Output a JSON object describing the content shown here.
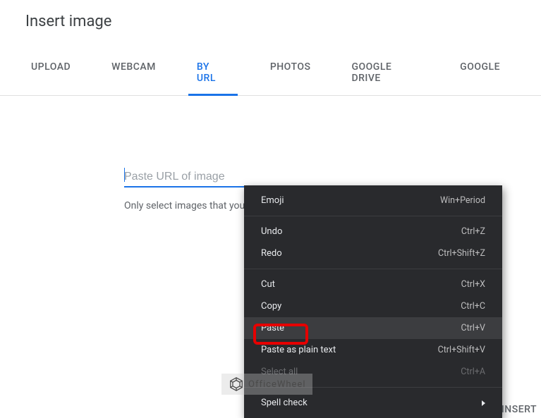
{
  "dialog": {
    "title": "Insert image"
  },
  "tabs": {
    "items": [
      {
        "label": "UPLOAD"
      },
      {
        "label": "WEBCAM"
      },
      {
        "label": "BY URL"
      },
      {
        "label": "PHOTOS"
      },
      {
        "label": "GOOGLE DRIVE"
      },
      {
        "label": "GOOGLE"
      }
    ],
    "active_index": 2
  },
  "url_field": {
    "placeholder": "Paste URL of image",
    "value": "",
    "helper": "Only select images that you have confirmed that you have the license to use."
  },
  "context_menu": {
    "items": [
      {
        "label": "Emoji",
        "shortcut": "Win+Period",
        "type": "item"
      },
      {
        "type": "sep"
      },
      {
        "label": "Undo",
        "shortcut": "Ctrl+Z",
        "type": "item"
      },
      {
        "label": "Redo",
        "shortcut": "Ctrl+Shift+Z",
        "type": "item"
      },
      {
        "type": "sep"
      },
      {
        "label": "Cut",
        "shortcut": "Ctrl+X",
        "type": "item"
      },
      {
        "label": "Copy",
        "shortcut": "Ctrl+C",
        "type": "item"
      },
      {
        "label": "Paste",
        "shortcut": "Ctrl+V",
        "type": "item",
        "hover": true,
        "highlighted": true
      },
      {
        "label": "Paste as plain text",
        "shortcut": "Ctrl+Shift+V",
        "type": "item"
      },
      {
        "label": "Select all",
        "shortcut": "Ctrl+A",
        "type": "item",
        "disabled": true
      },
      {
        "type": "sep"
      },
      {
        "label": "Spell check",
        "shortcut": "",
        "type": "submenu"
      }
    ]
  },
  "footer": {
    "insert_label": "INSERT"
  },
  "watermark": {
    "text": "OfficeWheel"
  },
  "colors": {
    "accent": "#1a73e8",
    "highlight": "#e60000",
    "menubg": "#292a2d"
  }
}
